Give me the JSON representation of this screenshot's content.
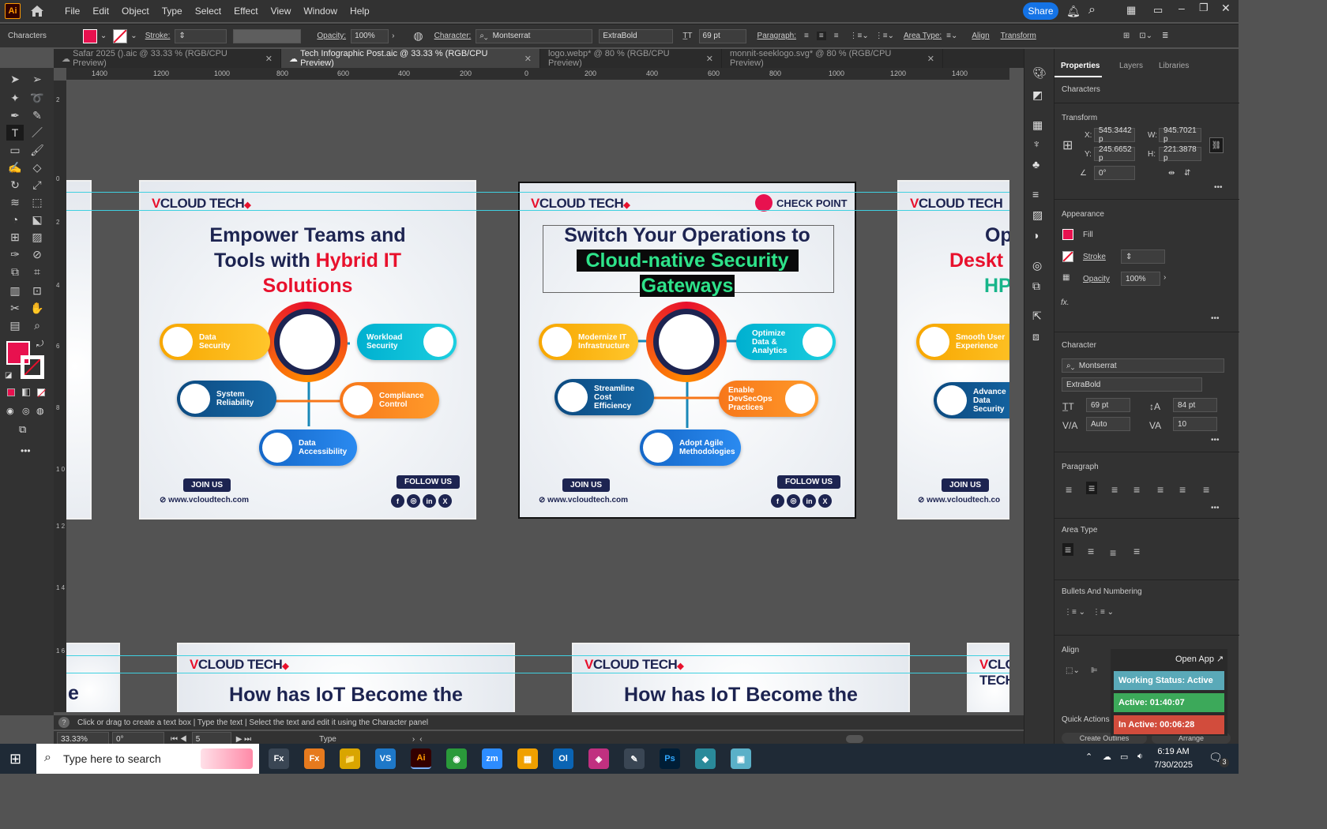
{
  "menubar": {
    "logo": "Ai",
    "items": [
      "File",
      "Edit",
      "Object",
      "Type",
      "Select",
      "Effect",
      "View",
      "Window",
      "Help"
    ],
    "share": "Share"
  },
  "controlbar": {
    "label": "Characters",
    "stroke": "Stroke:",
    "opacity_label": "Opacity:",
    "opacity": "100%",
    "character_label": "Character:",
    "font": "Montserrat",
    "weight": "ExtraBold",
    "size": "69 pt",
    "paragraph": "Paragraph:",
    "area_type": "Area Type:",
    "align": "Align",
    "transform": "Transform"
  },
  "tabs": [
    {
      "label": "Safar 2025 ().aic @ 33.33 % (RGB/CPU Preview)"
    },
    {
      "label": "Tech Infographic Post.aic @ 33.33 % (RGB/CPU Preview)"
    },
    {
      "label": "logo.webp* @ 80 % (RGB/CPU Preview)"
    },
    {
      "label": "monnit-seeklogo.svg* @ 80 % (RGB/CPU Preview)"
    }
  ],
  "ruler_top": [
    "1400",
    "1200",
    "1000",
    "800",
    "600",
    "400",
    "200",
    "0",
    "200",
    "400",
    "600",
    "800",
    "1000",
    "1200",
    "1400"
  ],
  "ruler_left": [
    "2",
    "0",
    "2",
    "4",
    "6",
    "8",
    "1 0",
    "1 2",
    "1 4",
    "1 6"
  ],
  "artboard1": {
    "brand_v": "V",
    "brand": "CLOUD TECH",
    "line1": "Empower Teams and",
    "line2a": "Tools with ",
    "line2b": "Hybrid IT",
    "line3": "Solutions",
    "pills": [
      "Data Security",
      "Workload Security",
      "System Reliability",
      "Compliance Control",
      "Data Accessibility"
    ],
    "join": "JOIN US",
    "follow": "FOLLOW US",
    "url": "www.vcloudtech.com"
  },
  "artboard2": {
    "brand_v": "V",
    "brand": "CLOUD TECH",
    "partner": "CHECK POINT",
    "line1": "Switch Your Operations to",
    "line2": "Cloud-native Security",
    "line3": "Gateways",
    "pills": [
      "Modernize IT Infrastructure",
      "Optimize Data & Analytics",
      "Streamline Cost Efficiency",
      "Enable DevSecOps Practices",
      "Adopt Agile Methodologies"
    ],
    "join": "JOIN US",
    "follow": "FOLLOW US",
    "url": "www.vcloudtech.com"
  },
  "artboard3": {
    "brand_v": "V",
    "brand": "CLOUD TECH",
    "line1": "Opt",
    "line2": "Deskt",
    "line3": "HP",
    "pills": [
      "Smooth User Experience",
      "Advance Data Security"
    ],
    "join": "JOIN US",
    "url": "www.vcloudtech.co"
  },
  "artboard_bottom": {
    "brand_v": "V",
    "brand": "CLOUD TECH",
    "headline": "How has IoT Become the",
    "left_letter": "e"
  },
  "social_icons": [
    "f",
    "◎",
    "in",
    "X"
  ],
  "status": {
    "hint": "Click or drag to create a text box  |  Type the text  |  Select the text and edit it using the Character panel",
    "zoom": "33.33%",
    "rotation": "0°",
    "artboard_num": "5",
    "tool": "Type"
  },
  "panel": {
    "tabs": [
      "Properties",
      "Layers",
      "Libraries"
    ],
    "characters": "Characters",
    "transform": "Transform",
    "x_label": "X:",
    "x": "545.3442 p",
    "y_label": "Y:",
    "y": "245.6652 p",
    "w_label": "W:",
    "w": "945.7021 p",
    "h_label": "H:",
    "h": "221.3878 p",
    "angle": "0°",
    "appearance": "Appearance",
    "fill": "Fill",
    "stroke": "Stroke",
    "opacity": "Opacity",
    "opacity_val": "100%",
    "fx": "fx.",
    "character": "Character",
    "font": "Montserrat",
    "weight": "ExtraBold",
    "size": "69 pt",
    "leading": "84 pt",
    "kerning": "Auto",
    "tracking": "10",
    "paragraph": "Paragraph",
    "area_type": "Area Type",
    "bullets": "Bullets And Numbering",
    "align": "Align",
    "quick_actions": "Quick Actions",
    "create_outlines": "Create Outlines",
    "arrange": "Arrange"
  },
  "widget": {
    "open_app": "Open App ↗",
    "status": "Working Status: Active",
    "active": "Active: 01:40:07",
    "inactive": "In Active: 00:06:28"
  },
  "taskbar": {
    "search": "Type here to search",
    "time": "6:19 AM",
    "date": "7/30/2025",
    "notif": "3",
    "apps": [
      "Fx",
      "📁",
      "VS",
      "Ai",
      "◉",
      "zm",
      "▦",
      "Ol",
      "◈",
      "✎",
      "Ps",
      "◆",
      "▣"
    ]
  },
  "colors": {
    "fill": "#e8114f",
    "accent": "#1473e6",
    "brand_navy": "#1d2451",
    "brand_red": "#e8112d",
    "highlight_green": "#2ee38a"
  }
}
